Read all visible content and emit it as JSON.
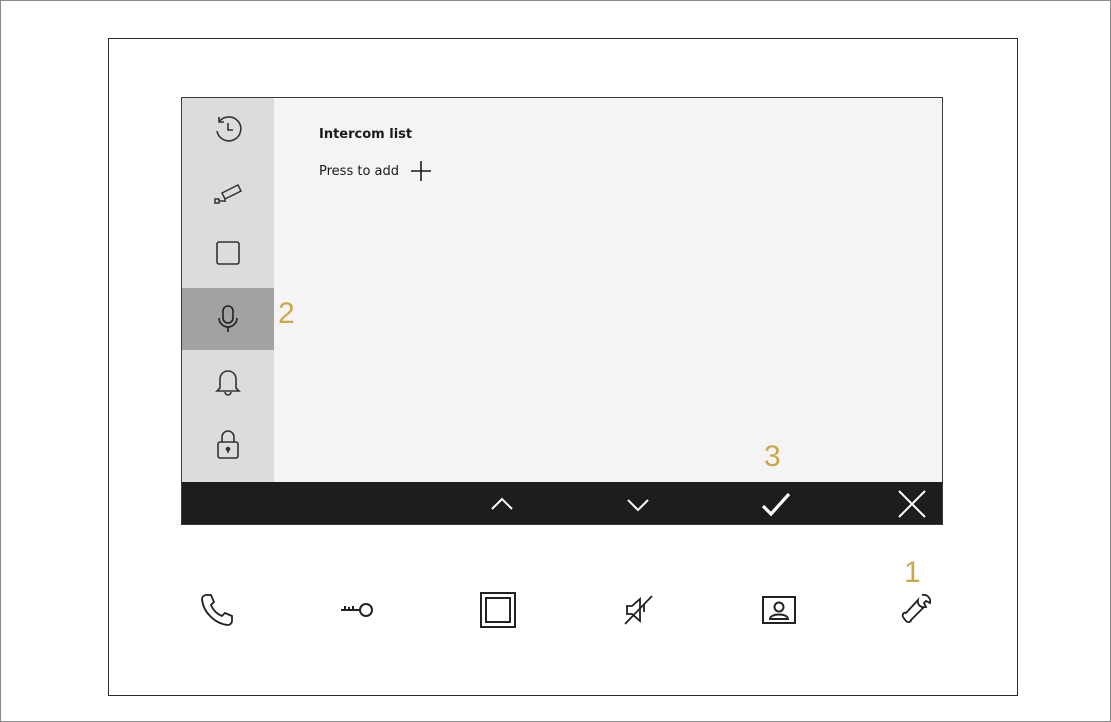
{
  "content": {
    "title": "Intercom list",
    "add_label": "Press to add"
  },
  "sidebar": {
    "items": [
      {
        "icon": "history-icon",
        "active": false
      },
      {
        "icon": "camera-icon",
        "active": false
      },
      {
        "icon": "square-icon",
        "active": false
      },
      {
        "icon": "microphone-icon",
        "active": true
      },
      {
        "icon": "bell-icon",
        "active": false
      },
      {
        "icon": "lock-icon",
        "active": false
      }
    ]
  },
  "bottom_bar": {
    "buttons": [
      "up-arrow-icon",
      "down-arrow-icon",
      "checkmark-icon",
      "close-icon"
    ]
  },
  "hardware_buttons": [
    "phone-icon",
    "key-icon",
    "square-frame-icon",
    "mute-speaker-icon",
    "contact-card-icon",
    "wrench-icon"
  ],
  "callouts": {
    "one": "1",
    "two": "2",
    "three": "3"
  },
  "colors": {
    "callout": "#c9a84c",
    "active_sidebar": "#a2a2a2",
    "sidebar": "#dcdcdc",
    "screen": "#f4f4f4",
    "bottom_bar": "#1d1d1d"
  }
}
